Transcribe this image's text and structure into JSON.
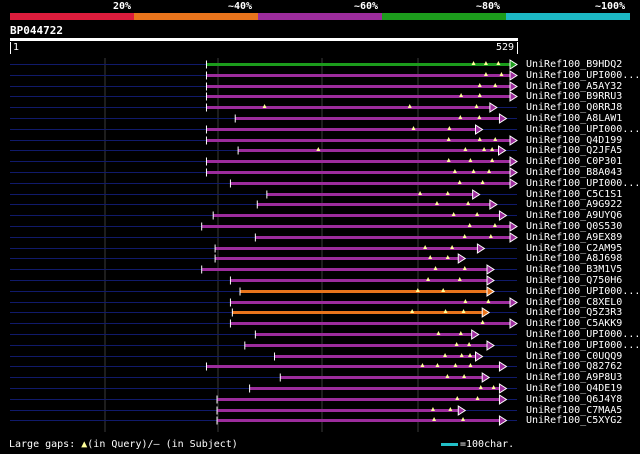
{
  "legend": {
    "labels": [
      "20%",
      "~40%",
      "~60%",
      "~80%",
      "~100%"
    ],
    "colors": [
      "#dc1c3c",
      "#e8741c",
      "#9c2c9c",
      "#1c9c1c",
      "#1cb8c4"
    ]
  },
  "query": {
    "name": "BP044722",
    "start": "1",
    "end": "529"
  },
  "colors": {
    "background": "#000000",
    "dim_line": "#101a6a",
    "grid": "#3a3a3a",
    "gap_marker": "#ffff99"
  },
  "hits": [
    {
      "label": "UniRef100_B9HDQ2",
      "color": "#1c9c1c",
      "start": 205,
      "end": 529,
      "gaps": [
        0.86,
        0.9,
        0.94
      ]
    },
    {
      "label": "UniRef100_UPI000...",
      "color": "#9c2c9c",
      "start": 205,
      "end": 529,
      "gaps": [
        0.9,
        0.95
      ]
    },
    {
      "label": "UniRef100_A5AY32",
      "color": "#9c2c9c",
      "start": 205,
      "end": 529,
      "gaps": [
        0.88,
        0.93
      ]
    },
    {
      "label": "UniRef100_B9RRU3",
      "color": "#9c2c9c",
      "start": 205,
      "end": 529,
      "gaps": [
        0.82,
        0.88
      ]
    },
    {
      "label": "UniRef100_Q0RRJ8",
      "color": "#9c2c9c",
      "start": 205,
      "end": 508,
      "gaps": [
        0.2,
        0.7,
        0.93
      ]
    },
    {
      "label": "UniRef100_A8LAW1",
      "color": "#9c2c9c",
      "start": 235,
      "end": 518,
      "gaps": [
        0.83,
        0.9
      ]
    },
    {
      "label": "UniRef100_UPI000...",
      "color": "#9c2c9c",
      "start": 205,
      "end": 493,
      "gaps": [
        0.75,
        0.88
      ]
    },
    {
      "label": "UniRef100_Q4D199",
      "color": "#9c2c9c",
      "start": 205,
      "end": 529,
      "gaps": [
        0.78,
        0.88,
        0.93
      ]
    },
    {
      "label": "UniRef100_Q2JFA5",
      "color": "#9c2c9c",
      "start": 238,
      "end": 517,
      "gaps": [
        0.3,
        0.85,
        0.92,
        0.95
      ]
    },
    {
      "label": "UniRef100_C0P301",
      "color": "#9c2c9c",
      "start": 205,
      "end": 529,
      "gaps": [
        0.78,
        0.85,
        0.92
      ]
    },
    {
      "label": "UniRef100_B8A043",
      "color": "#9c2c9c",
      "start": 205,
      "end": 529,
      "gaps": [
        0.8,
        0.86,
        0.91
      ]
    },
    {
      "label": "UniRef100_UPI000...",
      "color": "#9c2c9c",
      "start": 230,
      "end": 529,
      "gaps": [
        0.8,
        0.88
      ]
    },
    {
      "label": "UniRef100_C5C1S1",
      "color": "#9c2c9c",
      "start": 268,
      "end": 490,
      "gaps": [
        0.72,
        0.85
      ]
    },
    {
      "label": "UniRef100_A9G922",
      "color": "#9c2c9c",
      "start": 258,
      "end": 508,
      "gaps": [
        0.75,
        0.88
      ]
    },
    {
      "label": "UniRef100_A9UYQ6",
      "color": "#9c2c9c",
      "start": 212,
      "end": 518,
      "gaps": [
        0.82,
        0.9
      ]
    },
    {
      "label": "UniRef100_Q0S530",
      "color": "#9c2c9c",
      "start": 200,
      "end": 529,
      "gaps": [
        0.85,
        0.93
      ]
    },
    {
      "label": "UniRef100_A9EX89",
      "color": "#9c2c9c",
      "start": 256,
      "end": 529,
      "gaps": [
        0.8,
        0.9
      ]
    },
    {
      "label": "UniRef100_C2AM95",
      "color": "#9c2c9c",
      "start": 214,
      "end": 495,
      "gaps": [
        0.78,
        0.88
      ]
    },
    {
      "label": "UniRef100_A8J698",
      "color": "#9c2c9c",
      "start": 214,
      "end": 475,
      "gaps": [
        0.86,
        0.93
      ]
    },
    {
      "label": "UniRef100_B3M1V5",
      "color": "#9c2c9c",
      "start": 200,
      "end": 505,
      "gaps": [
        0.8,
        0.9
      ]
    },
    {
      "label": "UniRef100_Q750H6",
      "color": "#9c2c9c",
      "start": 230,
      "end": 505,
      "gaps": [
        0.75,
        0.87
      ]
    },
    {
      "label": "UniRef100_UPI000...",
      "color": "#e8741c",
      "start": 240,
      "end": 505,
      "gaps": [
        0.7,
        0.8
      ]
    },
    {
      "label": "UniRef100_C8XEL0",
      "color": "#9c2c9c",
      "start": 230,
      "end": 529,
      "gaps": [
        0.82,
        0.9
      ]
    },
    {
      "label": "UniRef100_Q5Z3R3",
      "color": "#e8741c",
      "start": 232,
      "end": 500,
      "gaps": [
        0.7,
        0.83,
        0.9
      ]
    },
    {
      "label": "UniRef100_C5AKK9",
      "color": "#9c2c9c",
      "start": 230,
      "end": 529,
      "gaps": [
        0.88
      ]
    },
    {
      "label": "UniRef100_UPI000...",
      "color": "#9c2c9c",
      "start": 256,
      "end": 489,
      "gaps": [
        0.82,
        0.92
      ]
    },
    {
      "label": "UniRef100_UPI000...",
      "color": "#9c2c9c",
      "start": 245,
      "end": 505,
      "gaps": [
        0.85,
        0.9
      ]
    },
    {
      "label": "UniRef100_C0UQQ9",
      "color": "#9c2c9c",
      "start": 276,
      "end": 493,
      "gaps": [
        0.82,
        0.9,
        0.94
      ]
    },
    {
      "label": "UniRef100_Q82762",
      "color": "#9c2c9c",
      "start": 205,
      "end": 518,
      "gaps": [
        0.72,
        0.77,
        0.83,
        0.88
      ]
    },
    {
      "label": "UniRef100_A9P8U3",
      "color": "#9c2c9c",
      "start": 282,
      "end": 500,
      "gaps": [
        0.8,
        0.88
      ]
    },
    {
      "label": "UniRef100_Q4DE19",
      "color": "#9c2c9c",
      "start": 250,
      "end": 518,
      "gaps": [
        0.9,
        0.95
      ]
    },
    {
      "label": "UniRef100_Q6J4Y8",
      "color": "#9c2c9c",
      "start": 216,
      "end": 518,
      "gaps": [
        0.83,
        0.9
      ]
    },
    {
      "label": "UniRef100_C7MAA5",
      "color": "#9c2c9c",
      "start": 216,
      "end": 475,
      "gaps": [
        0.87,
        0.94
      ]
    },
    {
      "label": "UniRef100_C5XYG2",
      "color": "#9c2c9c",
      "start": 216,
      "end": 518,
      "gaps": [
        0.75,
        0.85
      ]
    }
  ],
  "footer": {
    "legend_text": "Large gaps: ",
    "query_marker": "▲",
    "query_text": "(in Query)/",
    "subject_marker": "–",
    "subject_text": " (in Subject)",
    "scale_text": "=100char."
  }
}
